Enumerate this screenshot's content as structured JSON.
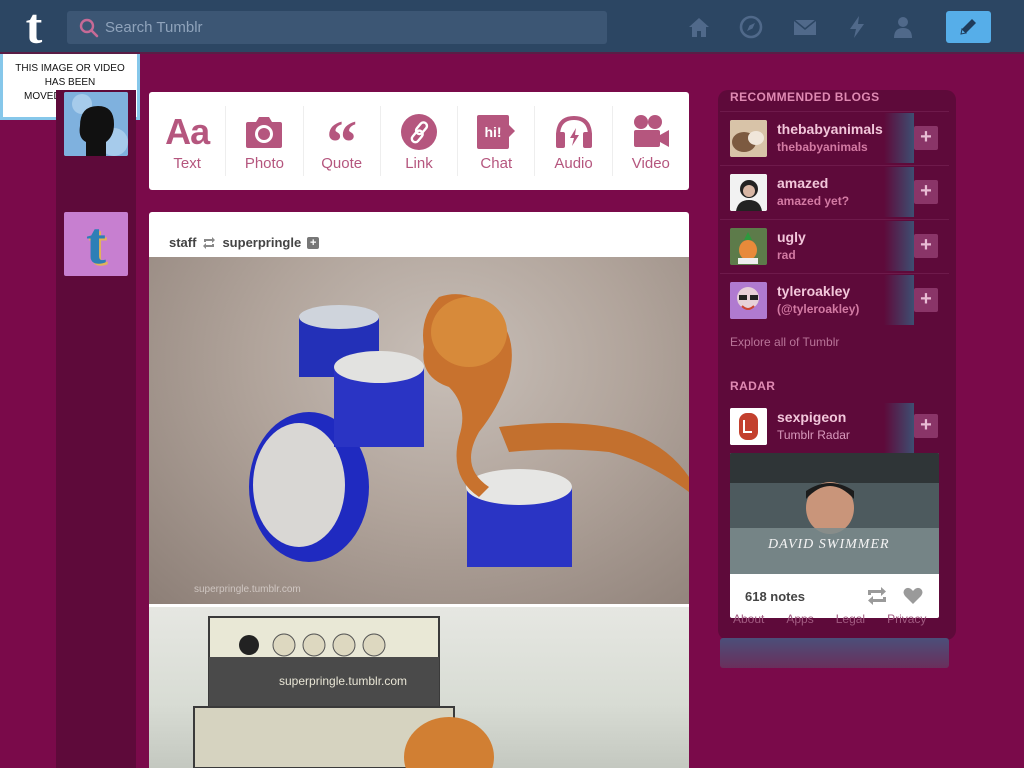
{
  "header": {
    "search_placeholder": "Search Tumblr",
    "nav_icons": [
      "home-icon",
      "compass-icon",
      "mail-icon",
      "lightning-icon",
      "person-icon"
    ],
    "compose_icon": "pencil-icon"
  },
  "broken_image": {
    "line1": "THIS IMAGE OR VIDEO",
    "line2": "HAS BEEN",
    "line3": "MOVED"
  },
  "post_types": [
    {
      "label": "Text",
      "icon": "text-aa-icon"
    },
    {
      "label": "Photo",
      "icon": "camera-icon"
    },
    {
      "label": "Quote",
      "icon": "quote-icon"
    },
    {
      "label": "Link",
      "icon": "link-icon"
    },
    {
      "label": "Chat",
      "icon": "chat-icon"
    },
    {
      "label": "Audio",
      "icon": "headphones-icon"
    },
    {
      "label": "Video",
      "icon": "video-camera-icon"
    }
  ],
  "post": {
    "author": "staff",
    "reblogged_from": "superpringle",
    "watermark1": "superpringle.tumblr.com",
    "watermark2": "superpringle.tumblr.com"
  },
  "sidebar": {
    "recommended_title": "RECOMMENDED BLOGS",
    "blogs": [
      {
        "name": "thebabyanimals",
        "subtitle": "thebabyanimals"
      },
      {
        "name": "amazed",
        "subtitle": "amazed yet?"
      },
      {
        "name": "ugly",
        "subtitle": "rad"
      },
      {
        "name": "tyleroakley",
        "subtitle": "(@tyleroakley)"
      }
    ],
    "explore_link": "Explore all of Tumblr",
    "radar_title": "RADAR",
    "radar": {
      "name": "sexpigeon",
      "subtitle": "Tumblr Radar",
      "caption": "DAVID SWIMMER",
      "notes": "618 notes"
    },
    "footer_links": [
      "About",
      "Apps",
      "Legal",
      "Privacy"
    ]
  },
  "colors": {
    "background": "#7a0a4a",
    "header": "#2c4663",
    "accent": "#b5567e",
    "compose": "#56aee9"
  }
}
